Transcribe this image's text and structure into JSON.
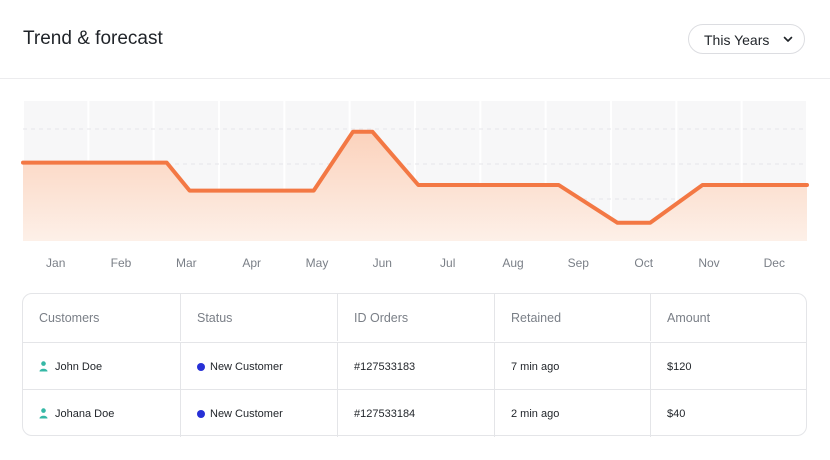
{
  "header": {
    "title": "Trend & forecast",
    "period_select": {
      "selected": "This Years",
      "icon": "chevron-down-icon"
    }
  },
  "chart_data": {
    "type": "area",
    "categories": [
      "Jan",
      "Feb",
      "Mar",
      "Apr",
      "May",
      "Jun",
      "Jul",
      "Aug",
      "Sep",
      "Oct",
      "Nov",
      "Dec"
    ],
    "series": [
      {
        "values": [
          56,
          56,
          36,
          36,
          78,
          40,
          40,
          13,
          40
        ]
      }
    ],
    "x_points": [
      0,
      2.2,
      2.55,
      4.45,
      5.05,
      5.35,
      6.05,
      8.2,
      9.1,
      9.6,
      10.4,
      10.95,
      12
    ],
    "values_at_points": [
      56,
      56,
      36,
      36,
      78,
      78,
      40,
      40,
      13,
      13,
      40,
      40,
      40
    ],
    "ylim": [
      0,
      100
    ],
    "grid": true,
    "colors": {
      "line": "#f37844",
      "fill_top": "#fbd2bc",
      "fill_bottom": "#fdf0e8",
      "band": "#f7f7f8",
      "month_label": "#7a7f87"
    }
  },
  "table": {
    "columns": [
      "Customers",
      "Status",
      "ID Orders",
      "Retained",
      "Amount"
    ],
    "rows": [
      {
        "customer": "John Doe",
        "status": "New Customer",
        "id": "#127533183",
        "retained": "7 min ago",
        "amount": "$120"
      },
      {
        "customer": "Johana Doe",
        "status": "New Customer",
        "id": "#127533184",
        "retained": "2 min ago",
        "amount": "$40"
      }
    ],
    "colors": {
      "person_icon": "#36b8a6",
      "status_dot": "#2730d6"
    }
  }
}
